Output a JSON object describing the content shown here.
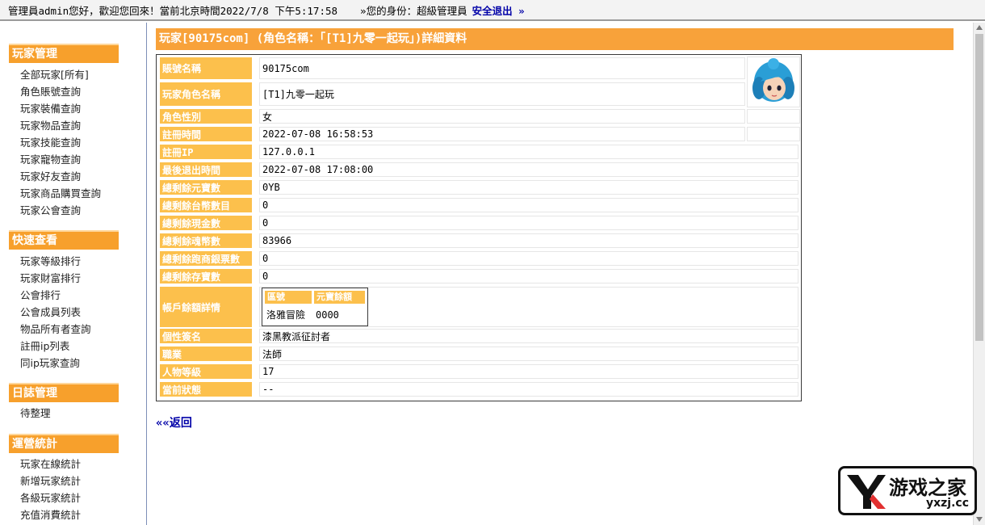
{
  "topbar": {
    "greeting": "管理員admin您好，歡迎您回來！當前北京時間2022/7/8 下午5:17:58",
    "role_label": "»您的身份：超級管理員",
    "logout": "安全退出 »"
  },
  "sidebar": {
    "sections": [
      {
        "title": "玩家管理",
        "items": [
          "全部玩家[所有]",
          "角色賬號查詢",
          "玩家裝備查詢",
          "玩家物品查詢",
          "玩家技能查詢",
          "玩家寵物查詢",
          "玩家好友查詢",
          "玩家商品購買查詢",
          "玩家公會查詢"
        ]
      },
      {
        "title": "快速查看",
        "items": [
          "玩家等級排行",
          "玩家財富排行",
          "公會排行",
          "公會成員列表",
          "物品所有者查詢",
          "註冊ip列表",
          "同ip玩家查詢"
        ]
      },
      {
        "title": "日誌管理",
        "items": [
          "待整理"
        ]
      },
      {
        "title": "運營統計",
        "items": [
          "玩家在線統計",
          "新增玩家統計",
          "各級玩家統計",
          "充值消費統計"
        ]
      }
    ]
  },
  "main": {
    "title": "玩家[90175com] (角色名稱：「[T1]九零一起玩」)詳細資料",
    "fields": [
      {
        "label": "賬號名稱",
        "value": "90175com"
      },
      {
        "label": "玩家角色名稱",
        "value": "[T1]九零一起玩"
      },
      {
        "label": "角色性別",
        "value": "女"
      },
      {
        "label": "註冊時間",
        "value": "2022-07-08 16:58:53"
      },
      {
        "label": "註冊IP",
        "value": "127.0.0.1"
      },
      {
        "label": "最後退出時間",
        "value": "2022-07-08 17:08:00"
      },
      {
        "label": "總剩餘元寶數",
        "value": "0YB"
      },
      {
        "label": "總剩餘台幣數目",
        "value": "0"
      },
      {
        "label": "總剩餘現金數",
        "value": "0"
      },
      {
        "label": "總剩餘魂幣數",
        "value": "83966"
      },
      {
        "label": "總剩餘跑商銀票數",
        "value": "0"
      },
      {
        "label": "總剩餘存寶數",
        "value": "0"
      },
      {
        "label": "帳戶餘額詳情",
        "value": ""
      },
      {
        "label": "個性簽名",
        "value": "漆黑教派征討者"
      },
      {
        "label": "職業",
        "value": "法師"
      },
      {
        "label": "人物等級",
        "value": "17"
      },
      {
        "label": "當前狀態",
        "value": "--"
      }
    ],
    "balance_table": {
      "headers": [
        "區號",
        "元寶餘額"
      ],
      "row": [
        "洛雅冒險",
        "0000"
      ]
    },
    "back_link": "««返回"
  },
  "watermark": {
    "text": "游戏之家",
    "url": "yxzj.cc"
  },
  "colors": {
    "accent": "#f8a23a",
    "label_bg": "#fcc04c",
    "link": "#0000a8"
  }
}
